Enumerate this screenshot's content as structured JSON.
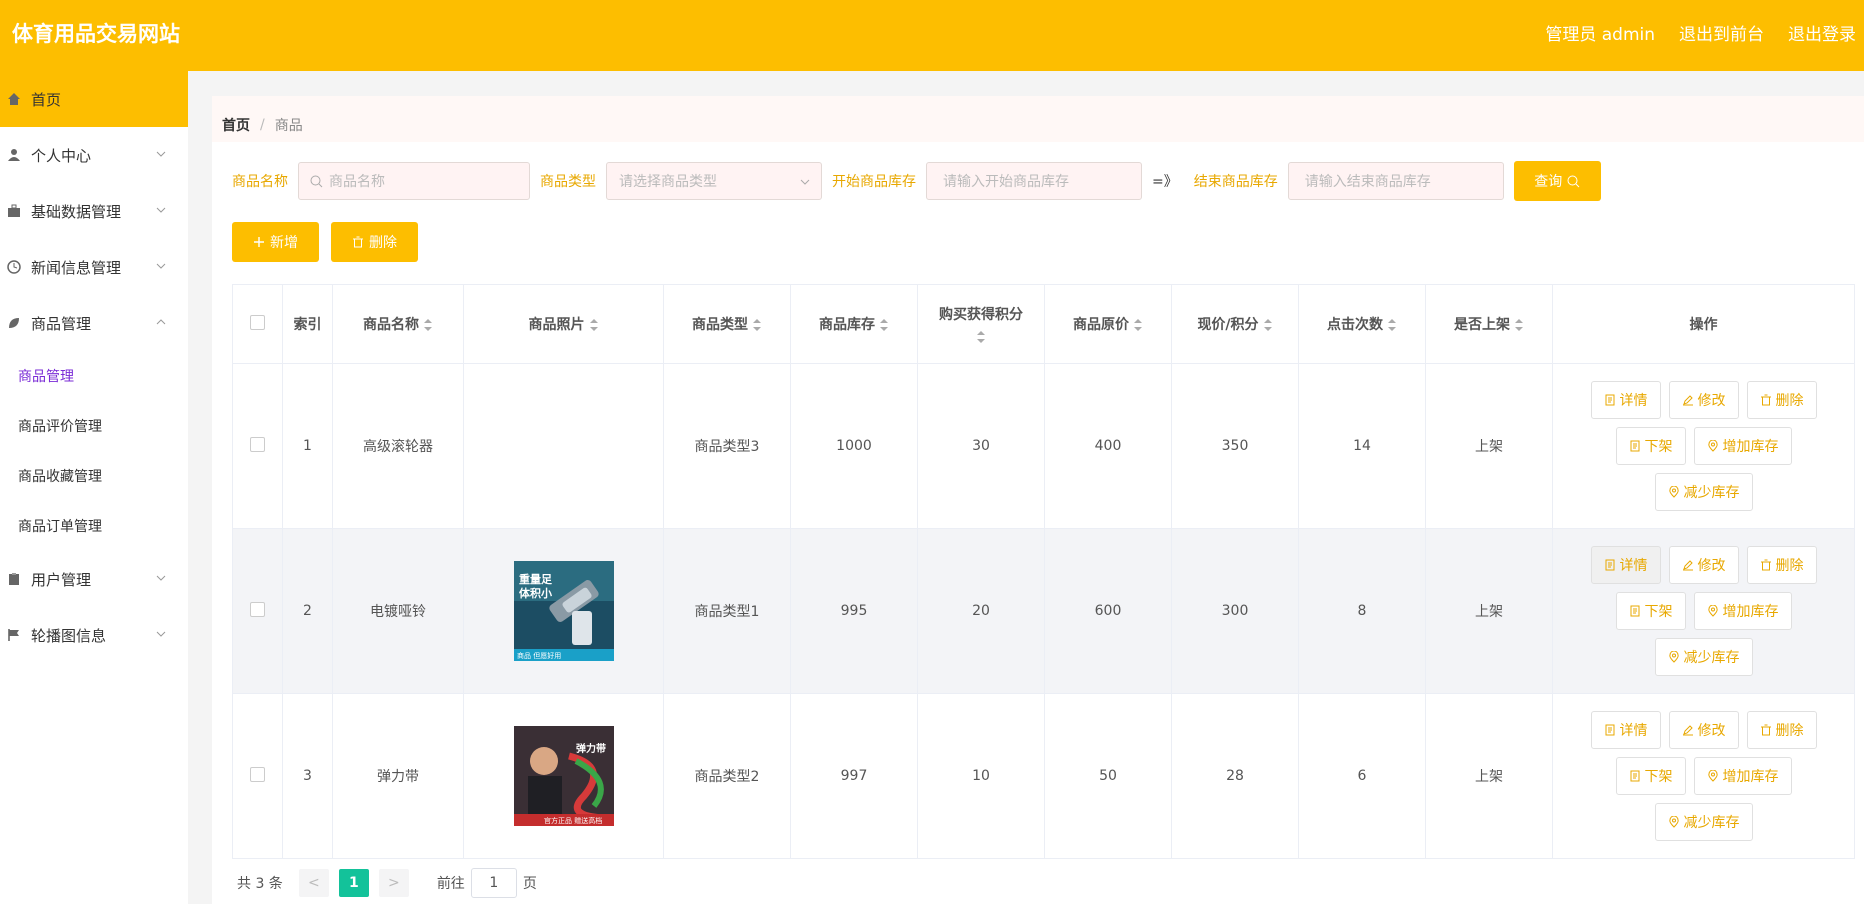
{
  "header": {
    "title": "体育用品交易网站",
    "user_label": "管理员 admin",
    "to_front_label": "退出到前台",
    "logout_label": "退出登录"
  },
  "sidebar": {
    "items": [
      {
        "label": "首页",
        "icon": "home-icon"
      },
      {
        "label": "个人中心",
        "icon": "user-icon"
      },
      {
        "label": "基础数据管理",
        "icon": "briefcase-icon"
      },
      {
        "label": "新闻信息管理",
        "icon": "clock-icon"
      },
      {
        "label": "商品管理",
        "icon": "leaf-icon"
      }
    ],
    "sub_items": [
      "商品管理",
      "商品评价管理",
      "商品收藏管理",
      "商品订单管理"
    ],
    "bottom_items": [
      {
        "label": "用户管理",
        "icon": "clipboard-icon"
      },
      {
        "label": "轮播图信息",
        "icon": "flag-icon"
      }
    ]
  },
  "breadcrumb": {
    "home": "首页",
    "separator": "/",
    "current": "商品"
  },
  "filters": {
    "name_label": "商品名称",
    "name_placeholder": "商品名称",
    "type_label": "商品类型",
    "type_placeholder": "请选择商品类型",
    "start_stock_label": "开始商品库存",
    "start_stock_placeholder": "请输入开始商品库存",
    "range_sep": "=》",
    "end_stock_label": "结束商品库存",
    "end_stock_placeholder": "请输入结束商品库存",
    "query_label": "查询"
  },
  "actions": {
    "add_label": "新增",
    "delete_label": "删除"
  },
  "table": {
    "headers": [
      "索引",
      "商品名称",
      "商品照片",
      "商品类型",
      "商品库存",
      "购买获得积分",
      "商品原价",
      "现价/积分",
      "点击次数",
      "是否上架",
      "操作"
    ],
    "rows": [
      {
        "index": "1",
        "name": "高级滚轮器",
        "photo": "",
        "type": "商品类型3",
        "stock": "1000",
        "points": "30",
        "price": "400",
        "current": "350",
        "clicks": "14",
        "status": "上架"
      },
      {
        "index": "2",
        "name": "电镀哑铃",
        "photo": "dumbbell",
        "photo_text": "重量足\n体积小",
        "photo_caption": "商品 但愿好用",
        "type": "商品类型1",
        "stock": "995",
        "points": "20",
        "price": "600",
        "current": "300",
        "clicks": "8",
        "status": "上架"
      },
      {
        "index": "3",
        "name": "弹力带",
        "photo": "band",
        "photo_text": "弹力带",
        "photo_caption": "官方正品 赠送高档",
        "type": "商品类型2",
        "stock": "997",
        "points": "10",
        "price": "50",
        "current": "28",
        "clicks": "6",
        "status": "上架"
      }
    ],
    "op_labels": {
      "detail": "详情",
      "edit": "修改",
      "delete": "删除",
      "off_shelf": "下架",
      "add_stock": "增加库存",
      "reduce_stock": "减少库存"
    }
  },
  "pagination": {
    "total_text": "共 3 条",
    "prev": "<",
    "page": "1",
    "next": ">",
    "goto_label": "前往",
    "goto_value": "1",
    "page_suffix": "页"
  },
  "colors": {
    "accent": "#fdbe00",
    "active_sub": "#7a2bd6",
    "page_on": "#13c29a"
  }
}
